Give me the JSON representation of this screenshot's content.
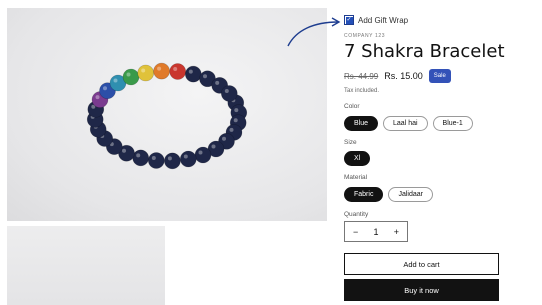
{
  "gift_wrap": {
    "label": "Add Gift Wrap",
    "checked": true
  },
  "product": {
    "vendor": "COMPANY 123",
    "title": "7 Shakra Bracelet",
    "price_old": "Rs. 44.99",
    "price_new": "Rs. 15.00",
    "badge": "Sale",
    "tax_note": "Tax included."
  },
  "options": {
    "color": {
      "label": "Color",
      "values": [
        "Blue",
        "Laal hai",
        "Blue-1"
      ],
      "selected": "Blue"
    },
    "size": {
      "label": "Size",
      "values": [
        "Xl"
      ],
      "selected": "Xl"
    },
    "material": {
      "label": "Material",
      "values": [
        "Fabric",
        "Jalidaar"
      ],
      "selected": "Fabric"
    }
  },
  "quantity": {
    "label": "Quantity",
    "value": "1",
    "decrease": "−",
    "increase": "+"
  },
  "buttons": {
    "add_to_cart": "Add to cart",
    "buy_now": "Buy it now"
  },
  "colors": {
    "accent": "#3352b8",
    "arrow": "#1e3d8f",
    "dark": "#121212"
  }
}
